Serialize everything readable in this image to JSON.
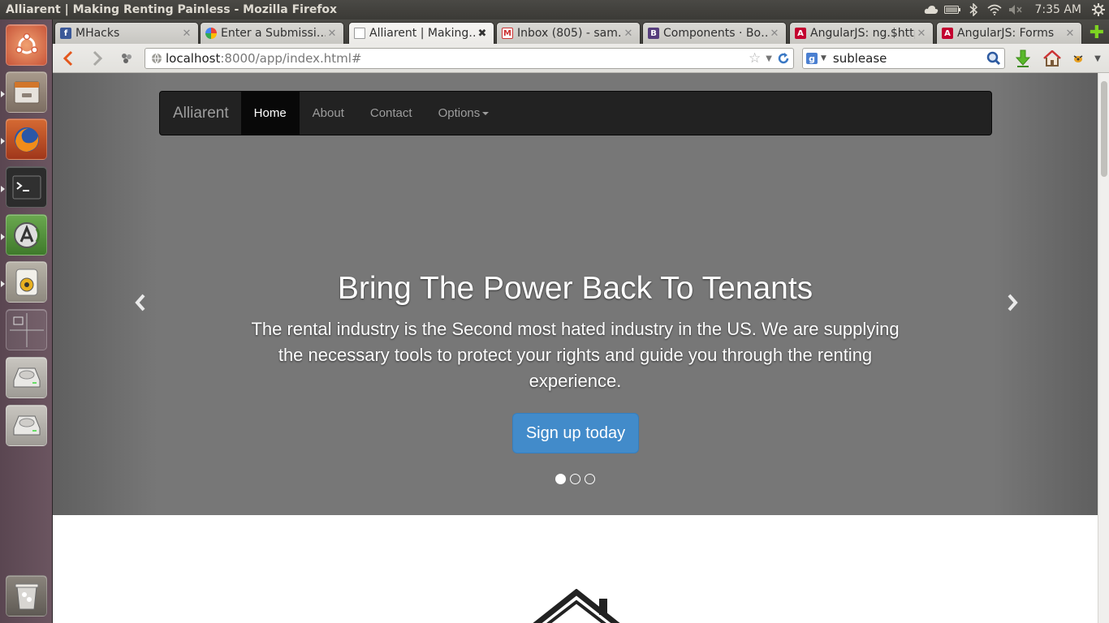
{
  "window": {
    "title": "Alliarent | Making Renting Painless - Mozilla Firefox",
    "clock": "7:35 AM"
  },
  "tabs": [
    {
      "label": "MHacks",
      "favicon": "facebook-icon"
    },
    {
      "label": "Enter a Submissi…",
      "favicon": "google-icon"
    },
    {
      "label": "Alliarent | Making…",
      "favicon": "blank-page-icon",
      "active": true
    },
    {
      "label": "Inbox (805) - sam…",
      "favicon": "gmail-icon"
    },
    {
      "label": "Components · Bo…",
      "favicon": "bootstrap-icon"
    },
    {
      "label": "AngularJS: ng.$http",
      "favicon": "angular-icon"
    },
    {
      "label": "AngularJS: Forms",
      "favicon": "angular-icon"
    }
  ],
  "urlbar": {
    "host": "localhost",
    "path": ":8000/app/index.html#"
  },
  "search": {
    "value": "sublease",
    "engine": "google-icon"
  },
  "site": {
    "brand": "Alliarent",
    "nav": [
      {
        "label": "Home",
        "active": true
      },
      {
        "label": "About"
      },
      {
        "label": "Contact"
      },
      {
        "label": "Options"
      }
    ],
    "hero": {
      "heading": "Bring The Power Back To Tenants",
      "text": "The rental industry is the Second most hated industry in the US. We are supplying the necessary tools to protect your rights and guide you through the renting experience.",
      "button": "Sign up today",
      "slides": 3,
      "active_slide": 1
    }
  },
  "colors": {
    "primary": "#428bca",
    "navbar": "#222222",
    "hero_bg": "#777777"
  }
}
